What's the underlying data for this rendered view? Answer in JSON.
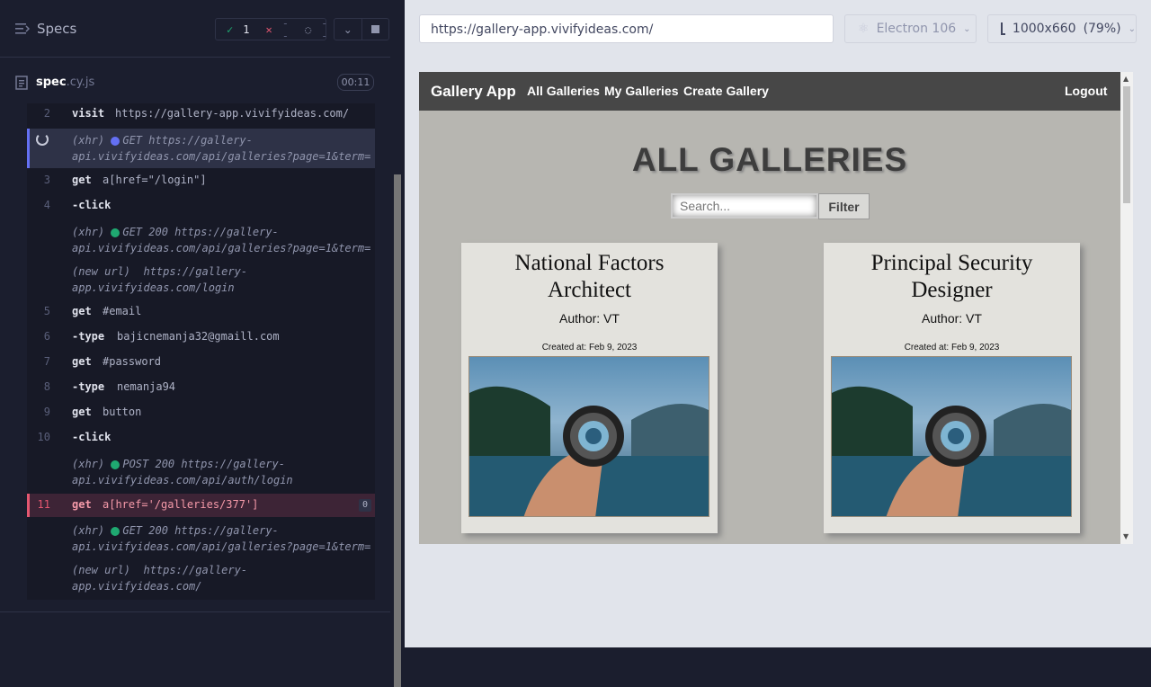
{
  "runner": {
    "specs_label": "Specs",
    "passed": "1",
    "failed": "--",
    "pending": "--",
    "spec_name": "spec",
    "spec_ext": ".cy.js",
    "timer": "00:11"
  },
  "commands": [
    {
      "num": "2",
      "name": "visit",
      "arg": "https://gallery-app.vivifyideas.com/"
    },
    {
      "type": "xhr",
      "label": "(xhr)",
      "method": "GET",
      "line1": "https://gallery-",
      "line2": "api.vivifyideas.com/api/galleries?page=1&term="
    },
    {
      "num": "3",
      "name": "get",
      "arg": "a[href=\"/login\"]"
    },
    {
      "num": "4",
      "name": "-click",
      "arg": ""
    },
    {
      "type": "xhr",
      "label": "(xhr)",
      "method": "GET 200",
      "line1": "https://gallery-",
      "line2": "api.vivifyideas.com/api/galleries?page=1&term="
    },
    {
      "type": "newurl",
      "label": "(new url)",
      "line1": "https://gallery-",
      "line2": "app.vivifyideas.com/login"
    },
    {
      "num": "5",
      "name": "get",
      "arg": "#email"
    },
    {
      "num": "6",
      "name": "-type",
      "arg": "bajicnemanja32@gmaill.com"
    },
    {
      "num": "7",
      "name": "get",
      "arg": "#password"
    },
    {
      "num": "8",
      "name": "-type",
      "arg": "nemanja94"
    },
    {
      "num": "9",
      "name": "get",
      "arg": "button"
    },
    {
      "num": "10",
      "name": "-click",
      "arg": ""
    },
    {
      "type": "xhr",
      "label": "(xhr)",
      "method": "POST 200",
      "line1": "https://gallery-",
      "line2": "api.vivifyideas.com/api/auth/login"
    },
    {
      "num": "11",
      "name": "get",
      "arg": "a[href='/galleries/377']",
      "badge": "0"
    },
    {
      "type": "xhr",
      "label": "(xhr)",
      "method": "GET 200",
      "line1": "https://gallery-",
      "line2": "api.vivifyideas.com/api/galleries?page=1&term="
    },
    {
      "type": "newurl",
      "label": "(new url)",
      "line1": "https://gallery-",
      "line2": "app.vivifyideas.com/"
    }
  ],
  "browser": {
    "url": "https://gallery-app.vivifyideas.com/",
    "engine": "Electron 106",
    "viewport": "1000x660",
    "zoom": "(79%)"
  },
  "app": {
    "brand": "Gallery App",
    "nav": [
      "All Galleries",
      "My Galleries",
      "Create Gallery"
    ],
    "logout": "Logout",
    "heading": "ALL GALLERIES",
    "search_placeholder": "Search...",
    "filter_label": "Filter",
    "cards": [
      {
        "title_line1": "National Factors",
        "title_line2": "Architect",
        "author": "Author: VT",
        "created": "Created at: Feb 9, 2023"
      },
      {
        "title_line1": "Principal Security",
        "title_line2": "Designer",
        "author": "Author: VT",
        "created": "Created at: Feb 9, 2023"
      }
    ]
  },
  "colors": {
    "xhr_active": "#6470f3",
    "xhr_done": "#1fa971",
    "pass": "#1fa971",
    "fail": "#e45770",
    "failed_row": "#3d2436"
  }
}
